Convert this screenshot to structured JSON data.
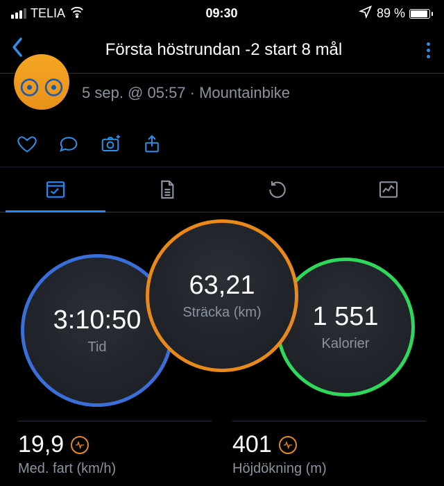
{
  "status": {
    "carrier": "TELIA",
    "time": "09:30",
    "battery_pct": "89 %"
  },
  "nav": {
    "title": "Första höstrundan -2 start 8 mål"
  },
  "activity": {
    "meta": "5 sep. @ 05:57 · Mountainbike"
  },
  "rings": {
    "center": {
      "value": "63,21",
      "label": "Sträcka (km)"
    },
    "left": {
      "value": "3:10:50",
      "label": "Tid"
    },
    "right": {
      "value": "1 551",
      "label": "Kalorier"
    }
  },
  "stats": {
    "speed": {
      "value": "19,9",
      "label": "Med. fart (km/h)"
    },
    "elev": {
      "value": "401",
      "label": "Höjdökning (m)"
    }
  }
}
